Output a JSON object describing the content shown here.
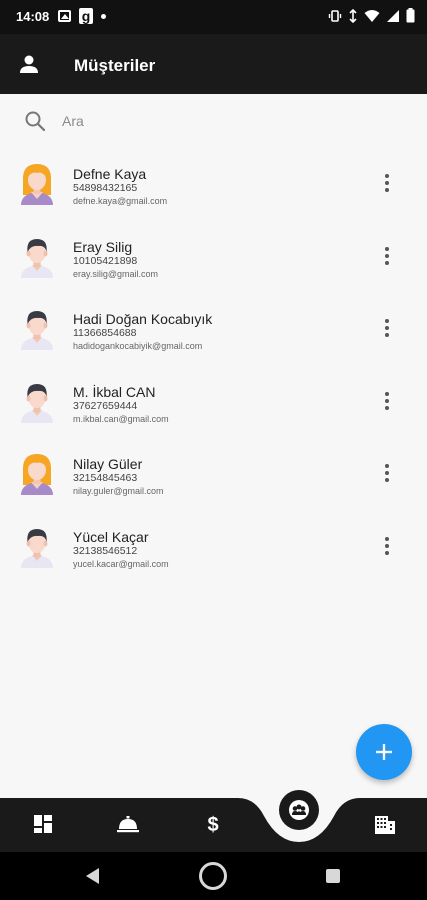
{
  "status_bar": {
    "time": "14:08"
  },
  "app_bar": {
    "title": "Müşteriler",
    "icon": "person-icon"
  },
  "search": {
    "placeholder": "Ara",
    "value": ""
  },
  "customers": [
    {
      "name": "Defne Kaya",
      "phone": "54898432165",
      "email": "defne.kaya@gmail.com",
      "avatar": "female"
    },
    {
      "name": "Eray Silig",
      "phone": "10105421898",
      "email": "eray.silig@gmail.com",
      "avatar": "male"
    },
    {
      "name": "Hadi Doğan Kocabıyık",
      "phone": "11366854688",
      "email": "hadidogankocabiyik@gmail.com",
      "avatar": "male"
    },
    {
      "name": "M. İkbal CAN",
      "phone": "37627659444",
      "email": "m.ikbal.can@gmail.com",
      "avatar": "male"
    },
    {
      "name": "Nilay Güler",
      "phone": "32154845463",
      "email": "nilay.guler@gmail.com",
      "avatar": "female"
    },
    {
      "name": "Yücel Kaçar",
      "phone": "32138546512",
      "email": "yucel.kacar@gmail.com",
      "avatar": "male"
    }
  ],
  "bottom_nav": {
    "items": [
      "dashboard-icon",
      "service-bell-icon",
      "dollar-icon",
      "customers-icon",
      "building-icon"
    ],
    "active": "customers-icon"
  },
  "colors": {
    "accent": "#2196f3",
    "bar": "#1a1a1a",
    "background": "#f7f7f7"
  }
}
